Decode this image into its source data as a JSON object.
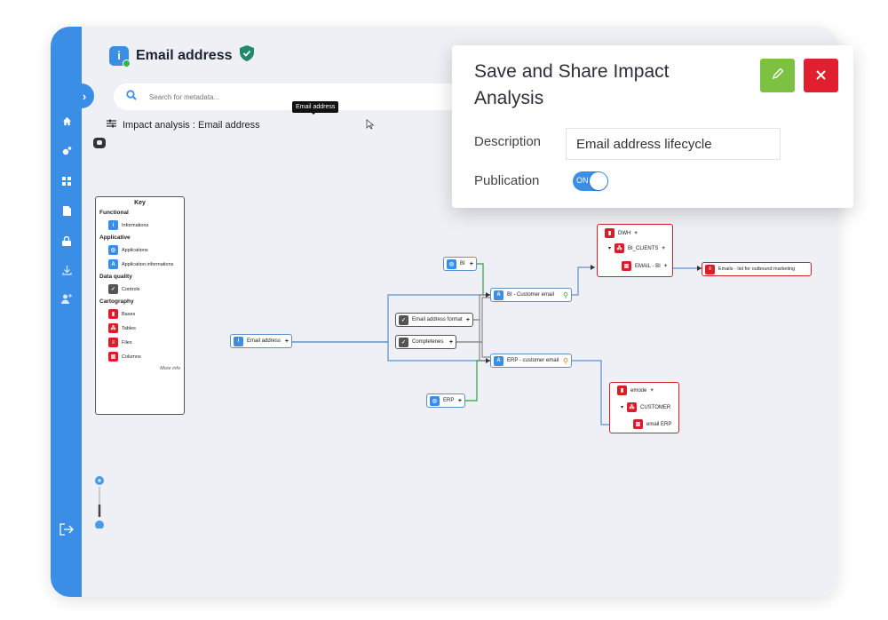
{
  "page": {
    "title": "Email address",
    "search_placeholder": "Search for metadata...",
    "tooltip": "Email address",
    "breadcrumb": "Impact analysis : Email address"
  },
  "sidebar": {
    "icons": [
      "home-icon",
      "settings-icon",
      "apps-icon",
      "document-icon",
      "lock-icon",
      "download-icon",
      "add-user-icon"
    ],
    "logout_icon": "logout-icon"
  },
  "key": {
    "title": "Key",
    "sections": [
      {
        "title": "Functional",
        "items": [
          "Informations"
        ]
      },
      {
        "title": "Applicative",
        "items": [
          "Applications",
          "Application informations"
        ]
      },
      {
        "title": "Data quality",
        "items": [
          "Controls"
        ]
      },
      {
        "title": "Cartography",
        "items": [
          "Bases",
          "Tables",
          "Files",
          "Columns"
        ]
      }
    ],
    "more": "More info"
  },
  "graph": {
    "email_node": "Email address",
    "bi_app": "BI",
    "erp_app": "ERP",
    "bi_info": "BI - Customer email",
    "erp_info": "ERP - customer email",
    "control_format": "Email address format",
    "control_complete": "Completenes",
    "dwh_base": "DWH",
    "dwh_table": "BI_CLIENTS",
    "dwh_column": "EMAIL - BI",
    "outbound_file": "Emails - list for outbound marketing",
    "emode_base": "emode",
    "emode_table": "CUSTOMER",
    "emode_column": "email ERP",
    "plus": "+"
  },
  "modal": {
    "title": "Save and Share Impact Analysis",
    "description_label": "Description",
    "description_value": "Email address lifecycle",
    "publication_label": "Publication",
    "toggle_label": "ON"
  },
  "colors": {
    "brand_blue": "#3a8ee6",
    "edit_green": "#7cc142",
    "close_red": "#e0202e",
    "base_red": "#d61f2c",
    "status_green": "#37b24d"
  }
}
